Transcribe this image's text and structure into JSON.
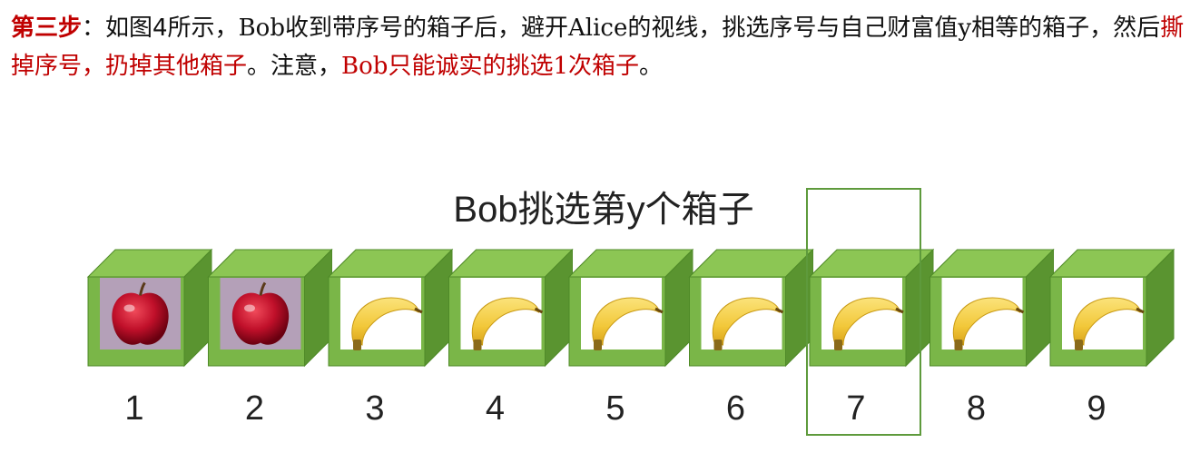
{
  "paragraph": {
    "step_label": "第三步",
    "part1": "：如图4所示，",
    "bob1": "Bob",
    "part2": "收到带序号的箱子后，避开",
    "alice": "Alice",
    "part3": "的视线，挑选序号与自己财富值",
    "y": "y",
    "part4": "相等的箱子，然后",
    "red1": "撕掉序号，扔掉其他箱子",
    "part5": "。注意，",
    "bob2": "Bob",
    "red2": "只能诚实的挑选",
    "one": "1",
    "red3": "次箱子",
    "part6": "。"
  },
  "figure": {
    "title": "Bob挑选第y个箱子",
    "selected_index": 7,
    "boxes": [
      {
        "number": "1",
        "content": "apple-icon"
      },
      {
        "number": "2",
        "content": "apple-icon"
      },
      {
        "number": "3",
        "content": "banana-icon"
      },
      {
        "number": "4",
        "content": "banana-icon"
      },
      {
        "number": "5",
        "content": "banana-icon"
      },
      {
        "number": "6",
        "content": "banana-icon"
      },
      {
        "number": "7",
        "content": "banana-icon"
      },
      {
        "number": "8",
        "content": "banana-icon"
      },
      {
        "number": "9",
        "content": "banana-icon"
      }
    ],
    "colors": {
      "box_front": "#7ab648",
      "box_side": "#5a9430",
      "box_top": "#8cc654",
      "apple_bg": "#b4a0b8",
      "apple": "#c0102a",
      "banana": "#f2cf3a",
      "highlight": "#5e9a3c"
    }
  }
}
